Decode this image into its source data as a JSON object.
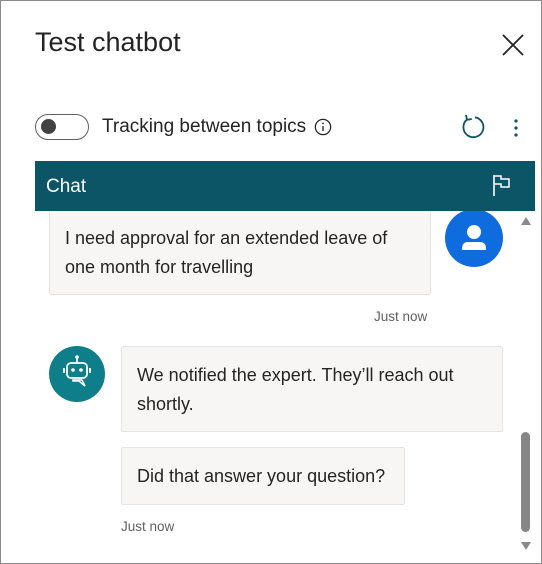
{
  "panel": {
    "title": "Test chatbot",
    "tracking_label": "Tracking between topics",
    "tracking_enabled": false
  },
  "chat": {
    "header_title": "Chat",
    "messages": [
      {
        "sender": "user",
        "text_line1": "I need approval for an extended leave of",
        "text_line2": "one month for travelling",
        "timestamp": "Just now"
      },
      {
        "sender": "bot",
        "text_line1": "We notified the expert. They’ll reach out",
        "text_line2": "shortly."
      },
      {
        "sender": "bot",
        "text_line1": "Did that answer your question?",
        "timestamp": "Just now"
      }
    ]
  },
  "colors": {
    "header_bg": "#0b5566",
    "user_avatar": "#0f6cde",
    "bot_avatar": "#0e7f8a",
    "bubble_bg": "#f7f6f5"
  },
  "icons": [
    "close-icon",
    "info-icon",
    "refresh-icon",
    "more-options-icon",
    "flag-icon",
    "user-avatar-icon",
    "bot-avatar-icon"
  ]
}
